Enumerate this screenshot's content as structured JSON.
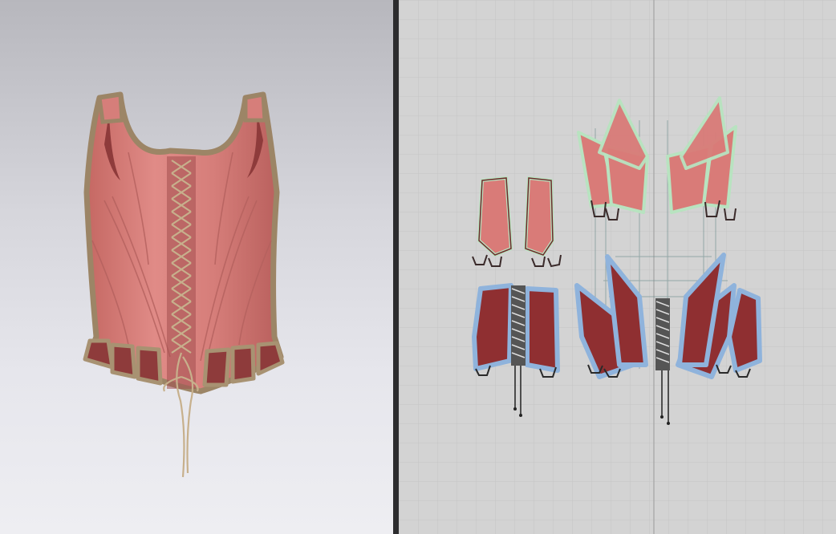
{
  "window": {
    "panes": [
      "3d-avatar-view",
      "2d-pattern-view"
    ]
  },
  "colors": {
    "fabric": "#d97b78",
    "fabric_shadow": "#b85a5a",
    "lining": "#8e3b3b",
    "binding": "#a89272",
    "back_piece": "#8f2f31",
    "selection_glow": "#8fb3dc",
    "seam_glow": "#b8e3c0",
    "grid": "#c4c4c4",
    "canvas": "#d3d3d3"
  },
  "icons": [
    "corset-garment",
    "lacing-cord",
    "pattern-piece"
  ]
}
